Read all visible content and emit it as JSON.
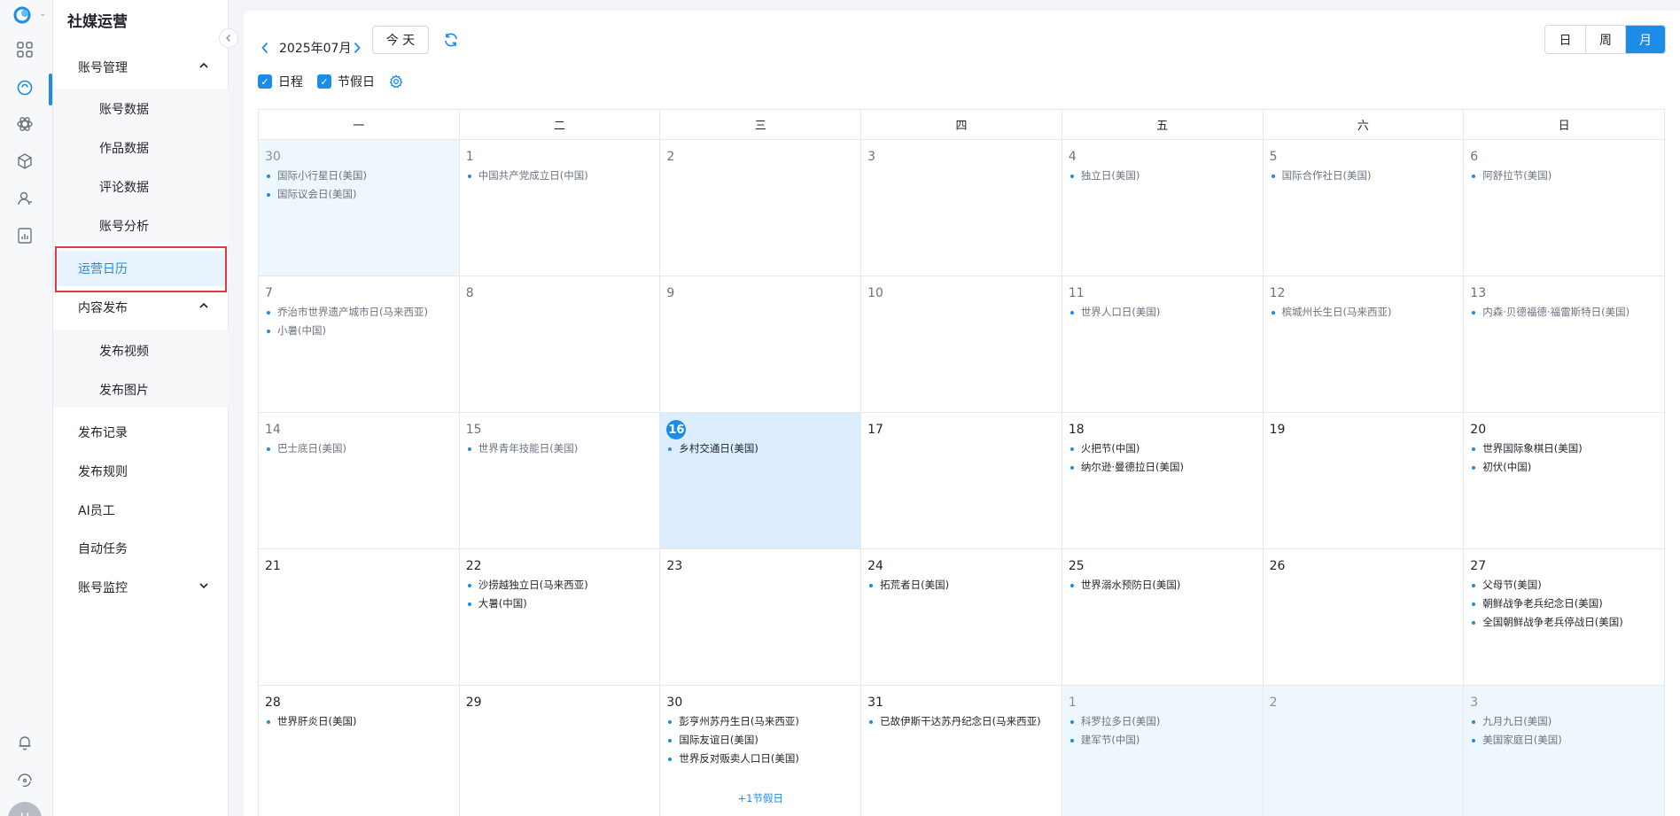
{
  "app": {
    "title": "社媒运营"
  },
  "rail": {
    "icons": [
      "logo-icon",
      "apps-grid-icon",
      "chat-icon",
      "atom-icon",
      "cube-icon",
      "user-icon",
      "report-icon",
      "bell-icon",
      "support-icon"
    ],
    "avatar_text": "U"
  },
  "sidebar": {
    "collapse_glyph": "‹",
    "groups": [
      {
        "label": "账号管理",
        "expanded": true,
        "children": [
          "账号数据",
          "作品数据",
          "评论数据",
          "账号分析"
        ]
      },
      {
        "label": "运营日历",
        "active": true
      },
      {
        "label": "内容发布",
        "expanded": true,
        "children": [
          "发布视频",
          "发布图片"
        ]
      },
      {
        "label": "发布记录"
      },
      {
        "label": "发布规则"
      },
      {
        "label": "AI员工"
      },
      {
        "label": "自动任务"
      },
      {
        "label": "账号监控",
        "expanded": false
      }
    ]
  },
  "toolbar": {
    "month": "2025年07月",
    "today_label": "今 天",
    "views": [
      "日",
      "周",
      "月"
    ],
    "active_view": "月",
    "checkboxes": [
      {
        "label": "日程",
        "checked": true
      },
      {
        "label": "节假日",
        "checked": true
      }
    ]
  },
  "calendar": {
    "weekdays": [
      "一",
      "二",
      "三",
      "四",
      "五",
      "六",
      "日"
    ],
    "weeks": [
      [
        {
          "day": "30",
          "other": true,
          "events": [
            "国际小行星日(美国)",
            "国际议会日(美国)"
          ]
        },
        {
          "day": "1",
          "past": true,
          "events": [
            "中国共产党成立日(中国)"
          ]
        },
        {
          "day": "2",
          "past": true,
          "events": []
        },
        {
          "day": "3",
          "past": true,
          "events": []
        },
        {
          "day": "4",
          "past": true,
          "events": [
            "独立日(美国)"
          ]
        },
        {
          "day": "5",
          "past": true,
          "events": [
            "国际合作社日(美国)"
          ]
        },
        {
          "day": "6",
          "past": true,
          "events": [
            "阿舒拉节(美国)"
          ]
        }
      ],
      [
        {
          "day": "7",
          "past": true,
          "events": [
            "乔治市世界遗产城市日(马来西亚)",
            "小暑(中国)"
          ]
        },
        {
          "day": "8",
          "past": true,
          "events": []
        },
        {
          "day": "9",
          "past": true,
          "events": []
        },
        {
          "day": "10",
          "past": true,
          "events": []
        },
        {
          "day": "11",
          "past": true,
          "events": [
            "世界人口日(美国)"
          ]
        },
        {
          "day": "12",
          "past": true,
          "events": [
            "槟城州长生日(马来西亚)"
          ]
        },
        {
          "day": "13",
          "past": true,
          "events": [
            "内森·贝德福德·福雷斯特日(美国)"
          ]
        }
      ],
      [
        {
          "day": "14",
          "past": true,
          "events": [
            "巴士底日(美国)"
          ]
        },
        {
          "day": "15",
          "past": true,
          "events": [
            "世界青年技能日(美国)"
          ]
        },
        {
          "day": "16",
          "today": true,
          "events": [
            "乡村交通日(美国)"
          ]
        },
        {
          "day": "17",
          "events": []
        },
        {
          "day": "18",
          "events": [
            "火把节(中国)",
            "纳尔逊·曼德拉日(美国)"
          ]
        },
        {
          "day": "19",
          "events": []
        },
        {
          "day": "20",
          "events": [
            "世界国际象棋日(美国)",
            "初伏(中国)"
          ]
        }
      ],
      [
        {
          "day": "21",
          "events": []
        },
        {
          "day": "22",
          "events": [
            "沙捞越独立日(马来西亚)",
            "大暑(中国)"
          ]
        },
        {
          "day": "23",
          "events": []
        },
        {
          "day": "24",
          "events": [
            "拓荒者日(美国)"
          ]
        },
        {
          "day": "25",
          "events": [
            "世界溺水预防日(美国)"
          ]
        },
        {
          "day": "26",
          "events": []
        },
        {
          "day": "27",
          "events": [
            "父母节(美国)",
            "朝鲜战争老兵纪念日(美国)",
            "全国朝鲜战争老兵停战日(美国)"
          ]
        }
      ],
      [
        {
          "day": "28",
          "events": [
            "世界肝炎日(美国)"
          ]
        },
        {
          "day": "29",
          "events": []
        },
        {
          "day": "30",
          "events": [
            "彭亨州苏丹生日(马来西亚)",
            "国际友谊日(美国)",
            "世界反对贩卖人口日(美国)"
          ],
          "more": "+1节假日"
        },
        {
          "day": "31",
          "events": [
            "已故伊斯干达苏丹纪念日(马来西亚)"
          ]
        },
        {
          "day": "1",
          "other": true,
          "events": [
            "科罗拉多日(美国)",
            "建军节(中国)"
          ]
        },
        {
          "day": "2",
          "other": true,
          "events": []
        },
        {
          "day": "3",
          "other": true,
          "events": [
            "九月九日(美国)",
            "美国家庭日(美国)"
          ]
        }
      ]
    ]
  },
  "colors": {
    "accent": "#1c8ce6",
    "highlight_border": "#e0393e",
    "other_month_bg": "#eef6fe",
    "today_bg": "#dceefd"
  }
}
